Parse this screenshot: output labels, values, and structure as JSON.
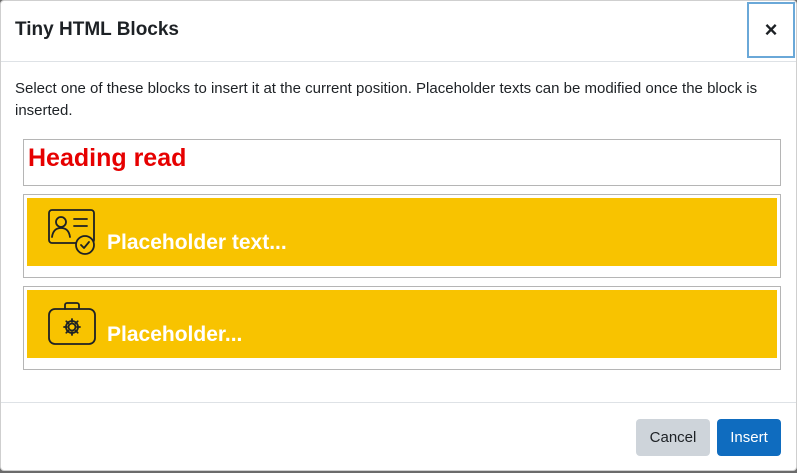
{
  "dialog": {
    "title": "Tiny HTML Blocks",
    "close_label": "×",
    "intro": "Select one of these blocks to insert it at the current position. Placeholder texts can be modified once the block is inserted."
  },
  "blocks": [
    {
      "kind": "heading",
      "text": "Heading read",
      "color": "#e60000"
    },
    {
      "kind": "banner",
      "icon": "id-card-check-icon",
      "text": "Placeholder text...",
      "background": "#f8c300"
    },
    {
      "kind": "banner",
      "icon": "toolbox-gear-icon",
      "text": "Placeholder...",
      "background": "#f8c300"
    }
  ],
  "footer": {
    "cancel_label": "Cancel",
    "insert_label": "Insert"
  },
  "colors": {
    "accent": "#0f6cbf",
    "secondary_button": "#ced4da"
  }
}
